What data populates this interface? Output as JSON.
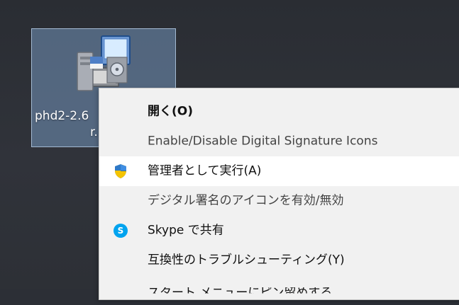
{
  "desktop": {
    "icon_label_line1": "phd2-2.6",
    "icon_label_line2": "r."
  },
  "context_menu": {
    "items": [
      {
        "label": "開く(O)",
        "icon": "",
        "bold": true,
        "highlighted": false
      },
      {
        "label": "Enable/Disable Digital Signature Icons",
        "icon": "",
        "bold": false,
        "highlighted": false
      },
      {
        "label": "管理者として実行(A)",
        "icon": "uac-shield-icon",
        "bold": false,
        "highlighted": true
      },
      {
        "label": "デジタル署名のアイコンを有効/無効",
        "icon": "",
        "bold": false,
        "highlighted": false
      },
      {
        "label": "Skype で共有",
        "icon": "skype-icon",
        "bold": false,
        "highlighted": false
      },
      {
        "label": "互換性のトラブルシューティング(Y)",
        "icon": "",
        "bold": false,
        "highlighted": false
      },
      {
        "label": "スタート メニューにピン留めする",
        "icon": "",
        "bold": false,
        "highlighted": false
      }
    ]
  },
  "colors": {
    "desktop_bg": "#2c2f36",
    "icon_selection": "#7ea4ce",
    "menu_bg": "#f1f1f1",
    "menu_hover": "#ffffff",
    "skype_blue": "#00a3ef",
    "uac_blue": "#2f79c6",
    "uac_yellow": "#f5c400"
  }
}
